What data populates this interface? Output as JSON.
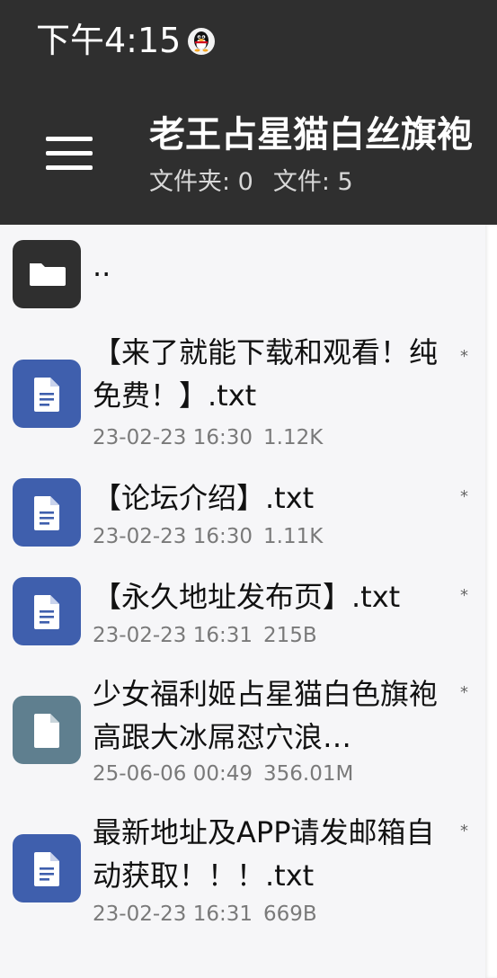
{
  "status_bar": {
    "time": "下午4:15",
    "notification_icon": "qq-penguin-icon"
  },
  "toolbar": {
    "menu_icon": "hamburger-menu-icon",
    "title": "老王占星猫白丝旗袍",
    "folders_label": "文件夹: 0",
    "files_label": "文件: 5"
  },
  "parent_entry": {
    "name": "..",
    "icon": "folder-icon"
  },
  "files": [
    {
      "name": "【来了就能下载和观看！纯免费！】.txt",
      "date": "23-02-23 16:30",
      "size": "1.12K",
      "mark": "*",
      "icon": "text-file-icon"
    },
    {
      "name": "【论坛介绍】.txt",
      "date": "23-02-23 16:30",
      "size": "1.11K",
      "mark": "*",
      "icon": "text-file-icon"
    },
    {
      "name": "【永久地址发布页】.txt",
      "date": "23-02-23 16:31",
      "size": "215B",
      "mark": "*",
      "icon": "text-file-icon"
    },
    {
      "name": "少女福利姬占星猫白色旗袍高跟大冰屌怼穴浪…",
      "date": "25-06-06 00:49",
      "size": "356.01M",
      "mark": "*",
      "icon": "generic-file-icon"
    },
    {
      "name": "最新地址及APP请发邮箱自动获取！！！.txt",
      "date": "23-02-23 16:31",
      "size": "669B",
      "mark": "*",
      "icon": "text-file-icon"
    }
  ],
  "colors": {
    "bar_bg": "#2f2f2f",
    "text_file_icon": "#3f5fad",
    "generic_file_icon": "#5f7f8f",
    "folder_icon_bg": "#2f2f2f"
  }
}
